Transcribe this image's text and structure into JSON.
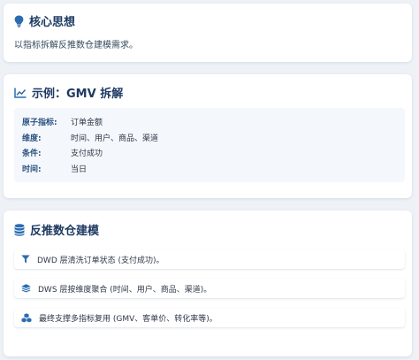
{
  "core": {
    "title": "核心思想",
    "text": "以指标拆解反推数仓建模需求。"
  },
  "example": {
    "title": "示例：GMV 拆解",
    "rows": [
      {
        "key": "原子指标:",
        "value": "订单金额"
      },
      {
        "key": "维度:",
        "value": "时间、用户、商品、渠道"
      },
      {
        "key": "条件:",
        "value": "支付成功"
      },
      {
        "key": "时间:",
        "value": "当日"
      }
    ]
  },
  "modeling": {
    "title": "反推数仓建模",
    "steps": [
      {
        "text": "DWD 层清洗订单状态 (支付成功)。",
        "icon": "filter-icon"
      },
      {
        "text": "DWS 层按维度聚合 (时间、用户、商品、渠道)。",
        "icon": "layers-icon"
      },
      {
        "text": "最终支撑多指标复用 (GMV、客单价、转化率等)。",
        "icon": "cubes-icon"
      }
    ]
  },
  "colors": {
    "accent": "#2b6cb0",
    "title": "#1f3a63",
    "background": "#eef2f7"
  }
}
